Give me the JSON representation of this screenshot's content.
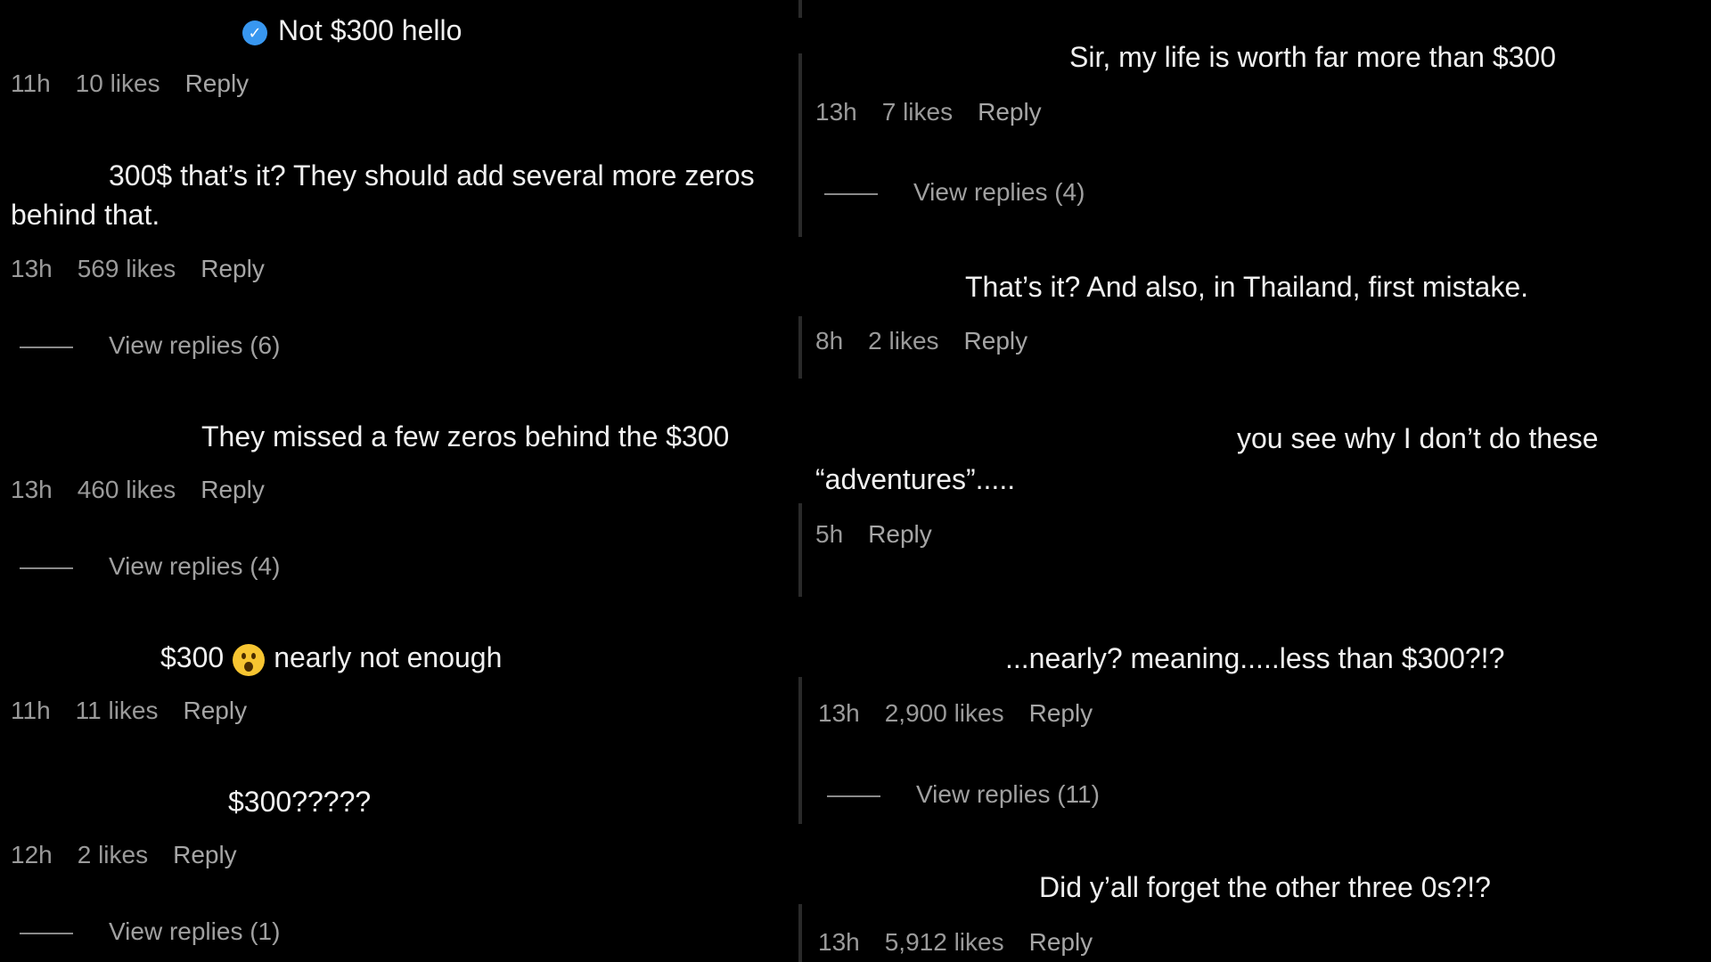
{
  "left": {
    "comments": [
      {
        "text": "Not $300 hello",
        "time": "11h",
        "likes": "10 likes",
        "reply": "Reply"
      },
      {
        "text": "300$ that’s it? They should add several more zeros behind that.",
        "time": "13h",
        "likes": "569 likes",
        "reply": "Reply",
        "view_replies": "View replies (6)"
      },
      {
        "text": "They missed a few zeros behind the $300",
        "time": "13h",
        "likes": "460 likes",
        "reply": "Reply",
        "view_replies": "View replies (4)"
      },
      {
        "text_before": "$300",
        "text_after": "nearly not enough",
        "emoji": "astonished-face",
        "time": "11h",
        "likes": "11 likes",
        "reply": "Reply"
      },
      {
        "text": "$300?????",
        "time": "12h",
        "likes": "2 likes",
        "reply": "Reply",
        "view_replies": "View replies (1)"
      }
    ]
  },
  "right": {
    "comments": [
      {
        "text": "Sir, my life is worth far more than $300",
        "time": "13h",
        "likes": "7 likes",
        "reply": "Reply",
        "view_replies": "View replies (4)"
      },
      {
        "text": "That’s it? And also, in Thailand, first mistake.",
        "time": "8h",
        "likes": "2 likes",
        "reply": "Reply"
      },
      {
        "text_line1": "you see why I don’t do these",
        "text_line2": "“adventures”.....",
        "time": "5h",
        "reply": "Reply"
      },
      {
        "text": "...nearly? meaning.....less than $300?!?",
        "time": "13h",
        "likes": "2,900 likes",
        "reply": "Reply",
        "view_replies": "View replies (11)"
      },
      {
        "text": "Did y’all forget the other three 0s?!?",
        "time": "13h",
        "likes": "5,912 likes",
        "reply": "Reply"
      }
    ]
  },
  "colors": {
    "background": "#000000",
    "text": "#f0f0f0",
    "meta": "#9a9a9a",
    "verified": "#3897f0"
  }
}
